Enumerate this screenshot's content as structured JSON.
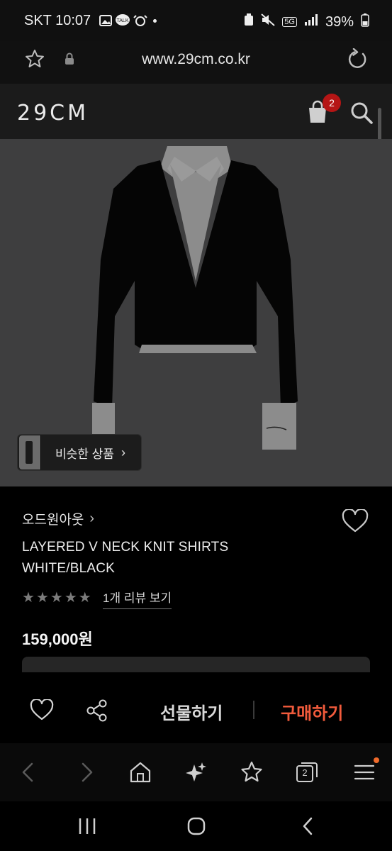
{
  "status_bar": {
    "carrier_time": "SKT 10:07",
    "battery": "39%",
    "network": "5G"
  },
  "browser": {
    "url": "www.29cm.co.kr"
  },
  "site": {
    "logo": "29CM",
    "cart_count": "2"
  },
  "hero": {
    "similar_label": "비슷한 상품",
    "similar_chevron": "›"
  },
  "product": {
    "brand": "오드원아웃",
    "brand_chevron": "›",
    "title_line1": "LAYERED V NECK KNIT SHIRTS",
    "title_line2": "WHITE/BLACK",
    "rating_stars": 5,
    "review_link": "1개 리뷰 보기",
    "price": "159,000원"
  },
  "actions": {
    "gift_label": "선물하기",
    "buy_label": "구매하기"
  },
  "browser_nav": {
    "tabs_count": "2"
  },
  "colors": {
    "buy_accent": "#f25b3c",
    "badge_red": "#b51515"
  }
}
